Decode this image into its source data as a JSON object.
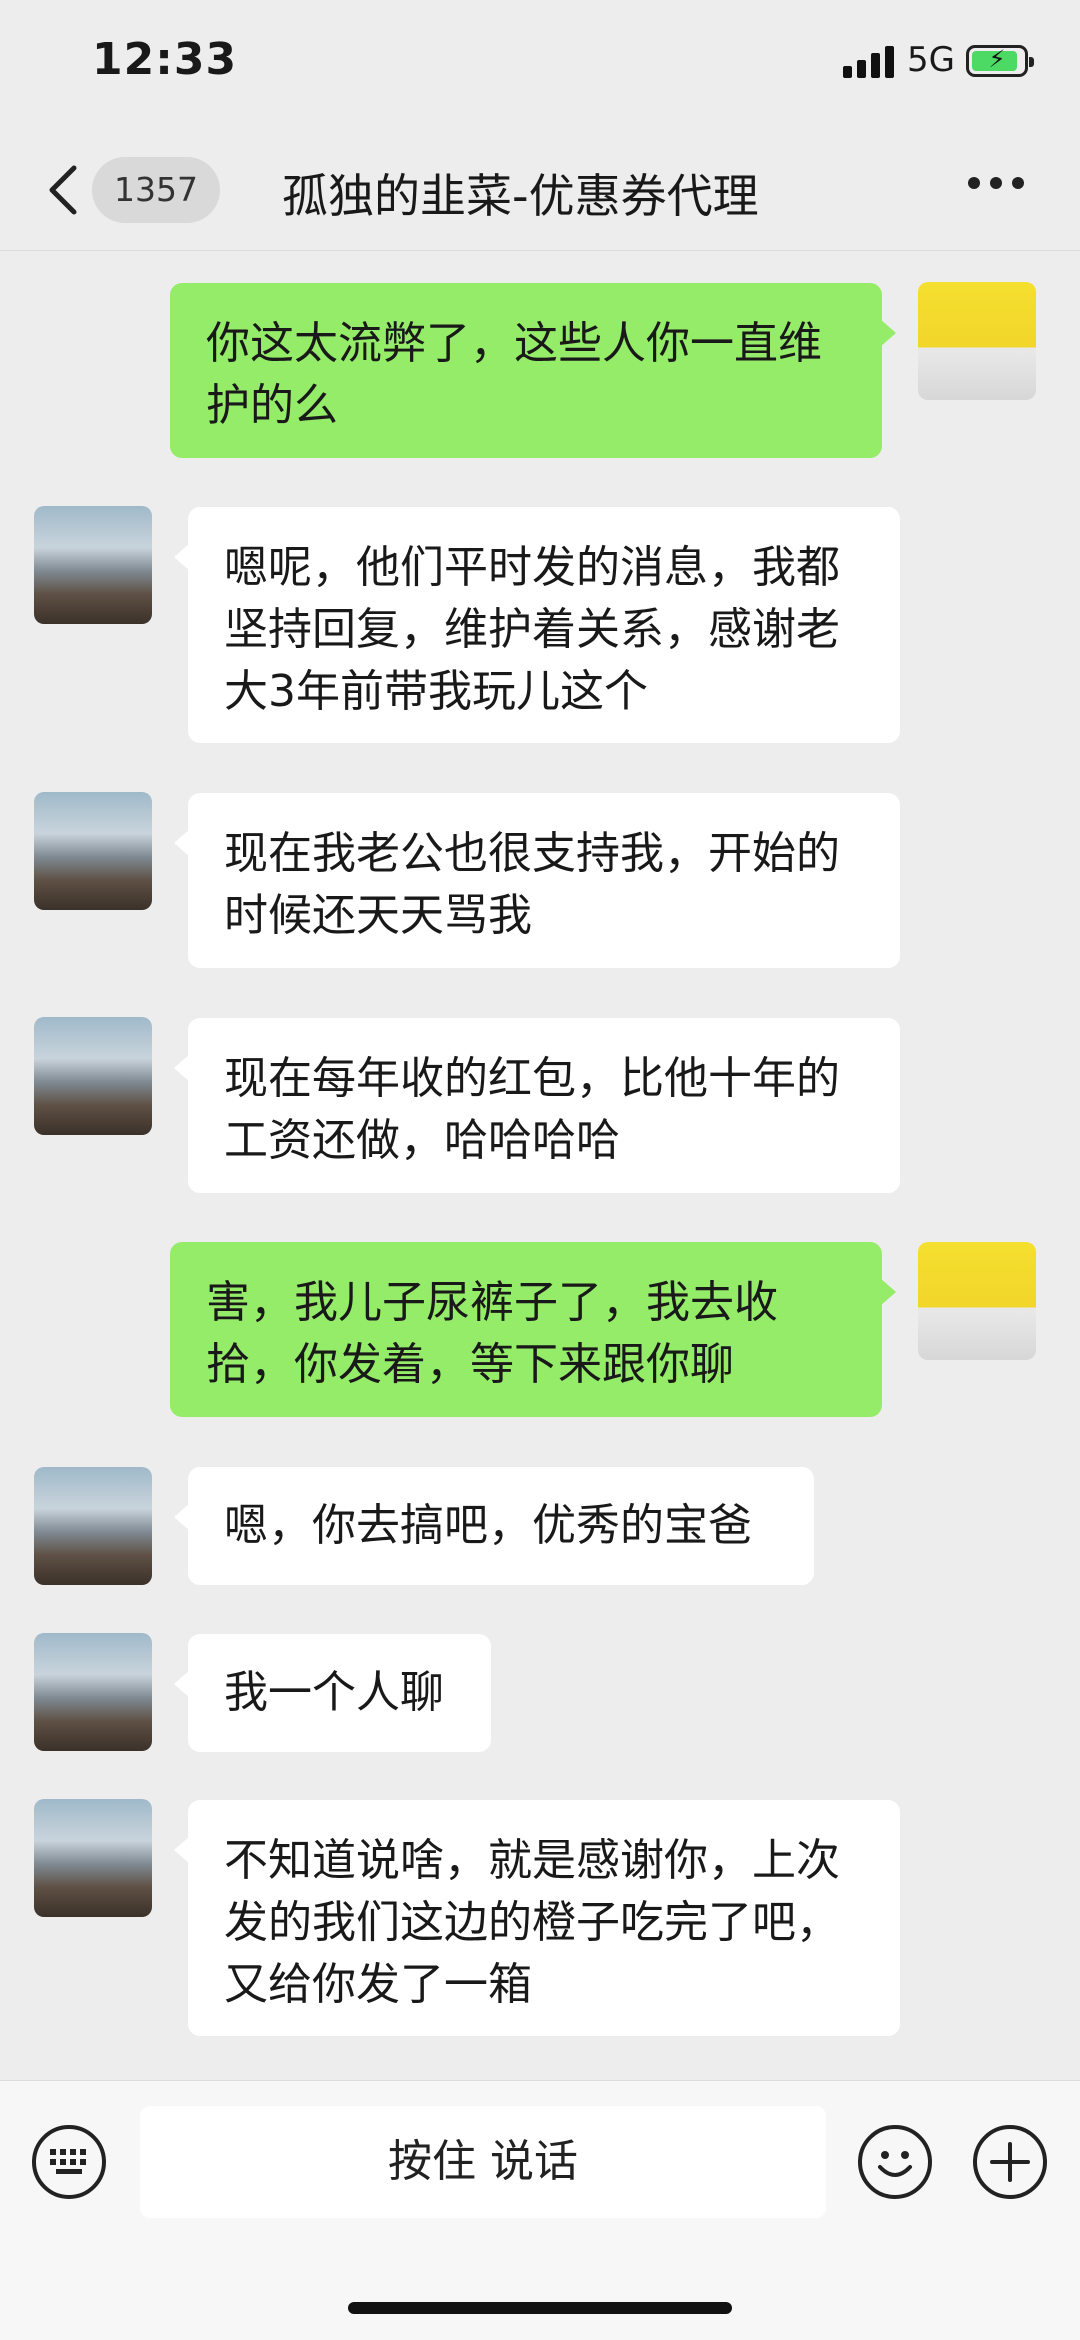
{
  "status_bar": {
    "time": "12:33",
    "network": "5G"
  },
  "nav": {
    "back_count": "1357",
    "title": "孤独的韭菜-优惠券代理"
  },
  "messages": [
    {
      "side": "right",
      "text": "你这太流弊了，这些人你一直维护的么"
    },
    {
      "side": "left",
      "text": "嗯呢，他们平时发的消息，我都坚持回复，维护着关系，感谢老大3年前带我玩儿这个"
    },
    {
      "side": "left",
      "text": "现在我老公也很支持我，开始的时候还天天骂我"
    },
    {
      "side": "left",
      "text": "现在每年收的红包，比他十年的工资还做，哈哈哈哈"
    },
    {
      "side": "right",
      "text": "害，我儿子尿裤子了，我去收拾，你发着，等下来跟你聊"
    },
    {
      "side": "left",
      "text": "嗯，你去搞吧，优秀的宝爸"
    },
    {
      "side": "left",
      "text": "我一个人聊"
    },
    {
      "side": "left",
      "text": "不知道说啥，就是感谢你，上次发的我们这边的橙子吃完了吧，又给你发了一箱"
    }
  ],
  "input_bar": {
    "hold_to_talk": "按住 说话"
  },
  "colors": {
    "background": "#ededed",
    "bubble_self": "#95ec69",
    "bubble_other": "#ffffff",
    "battery": "#4cd964"
  },
  "icons": [
    "back-chevron-icon",
    "more-icon",
    "keyboard-icon",
    "emoji-icon",
    "plus-icon"
  ]
}
